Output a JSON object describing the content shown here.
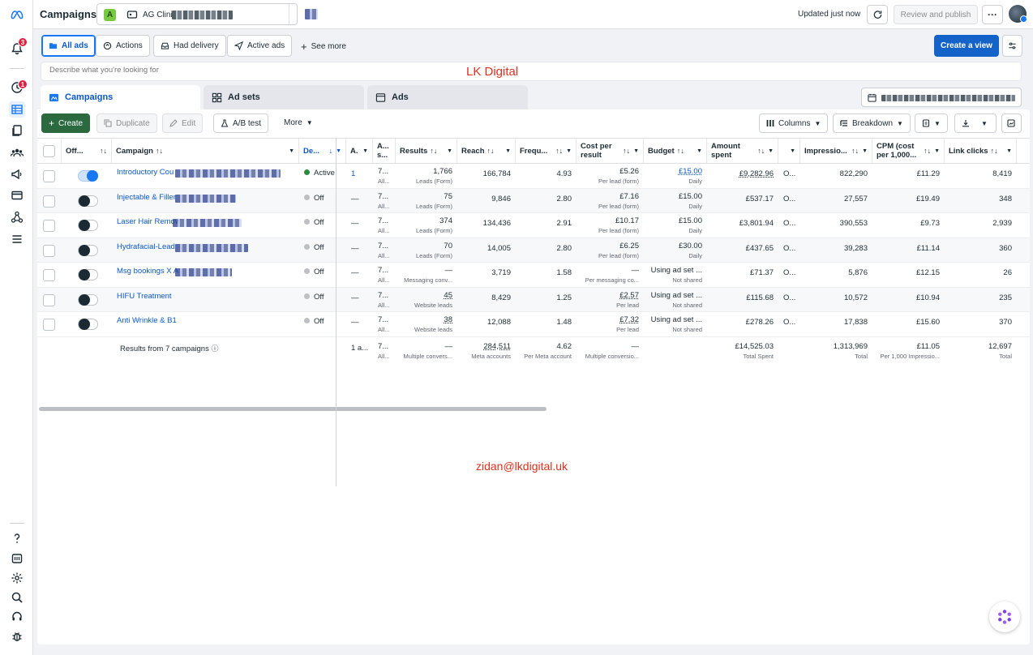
{
  "header": {
    "title": "Campaigns",
    "account_letter": "A",
    "account_name": "AG Clini",
    "updated": "Updated just now",
    "review_label": "Review and publish",
    "more_label": "···"
  },
  "rail": {
    "notifications_badge": "3",
    "activity_badge": "1"
  },
  "filters": {
    "chips": [
      "All ads",
      "Actions",
      "Had delivery",
      "Active ads"
    ],
    "see_more": "See more",
    "create_view": "Create a view"
  },
  "search": {
    "placeholder": "Describe what you're looking for"
  },
  "watermarks": {
    "top": "LK Digital",
    "bottom": "zidan@lkdigital.uk"
  },
  "tabs": [
    "Campaigns",
    "Ad sets",
    "Ads"
  ],
  "toolbar": {
    "create": "Create",
    "duplicate": "Duplicate",
    "edit": "Edit",
    "ab_test": "A/B test",
    "more": "More",
    "columns": "Columns",
    "breakdown": "Breakdown"
  },
  "table": {
    "headers": {
      "offon": "Off...",
      "campaign": "Campaign",
      "delivery": "De...",
      "a": "A.",
      "as": "A... s...",
      "results": "Results",
      "reach": "Reach",
      "frequency": "Frequ...",
      "cpr": "Cost per result",
      "budget": "Budget",
      "amount": "Amount spent",
      "impressions": "Impressio...",
      "cpm": "CPM (cost per 1,000...",
      "link_clicks": "Link clicks"
    },
    "rows": [
      {
        "name": "Introductory Cou",
        "on": true,
        "delivery": "Active",
        "delivery_color": "#2b8a3e",
        "a": "1",
        "as_main": "7...",
        "as_sub": "All...",
        "results": "1,766",
        "results_sub": "Leads (Form)",
        "reach": "166,784",
        "freq": "4.93",
        "cpr": "£5.26",
        "cpr_sub": "Per lead (form)",
        "budget": "£15.00",
        "budget_sub": "Daily",
        "amount": "£9,282.96",
        "o": "O...",
        "impr": "822,290",
        "cpm": "£11.29",
        "clicks": "8,419"
      },
      {
        "name": "Injectable & Filler",
        "on": false,
        "delivery": "Off",
        "delivery_color": "#bcc0c4",
        "a": "—",
        "as_main": "7...",
        "as_sub": "All...",
        "results": "75",
        "results_sub": "Leads (Form)",
        "reach": "9,846",
        "freq": "2.80",
        "cpr": "£7.16",
        "cpr_sub": "Per lead (form)",
        "budget": "£15.00",
        "budget_sub": "Daily",
        "amount": "£537.17",
        "o": "O...",
        "impr": "27,557",
        "cpm": "£19.49",
        "clicks": "348"
      },
      {
        "name": "Laser Hair Remov",
        "on": false,
        "delivery": "Off",
        "delivery_color": "#bcc0c4",
        "a": "—",
        "as_main": "7...",
        "as_sub": "All...",
        "results": "374",
        "results_sub": "Leads (Form)",
        "reach": "134,436",
        "freq": "2.91",
        "cpr": "£10.17",
        "cpr_sub": "Per lead (form)",
        "budget": "£15.00",
        "budget_sub": "Daily",
        "amount": "£3,801.94",
        "o": "O...",
        "impr": "390,553",
        "cpm": "£9.73",
        "clicks": "2,939"
      },
      {
        "name": "Hydrafacial-Lead",
        "on": false,
        "delivery": "Off",
        "delivery_color": "#bcc0c4",
        "a": "—",
        "as_main": "7...",
        "as_sub": "All...",
        "results": "70",
        "results_sub": "Leads (Form)",
        "reach": "14,005",
        "freq": "2.80",
        "cpr": "£6.25",
        "cpr_sub": "Per lead (form)",
        "budget": "£30.00",
        "budget_sub": "Daily",
        "amount": "£437.65",
        "o": "O...",
        "impr": "39,283",
        "cpm": "£11.14",
        "clicks": "360"
      },
      {
        "name": "Msg bookings X A",
        "on": false,
        "delivery": "Off",
        "delivery_color": "#bcc0c4",
        "a": "—",
        "as_main": "7...",
        "as_sub": "All...",
        "results": "—",
        "results_sub": "Messaging conv...",
        "reach": "3,719",
        "freq": "1.58",
        "cpr": "—",
        "cpr_sub": "Per messaging co...",
        "budget": "Using ad set ...",
        "budget_sub": "Not shared",
        "amount": "£71.37",
        "o": "O...",
        "impr": "5,876",
        "cpm": "£12.15",
        "clicks": "26"
      },
      {
        "name": "HIFU Treatment",
        "on": false,
        "delivery": "Off",
        "delivery_color": "#bcc0c4",
        "a": "—",
        "as_main": "7...",
        "as_sub": "All...",
        "results": "45",
        "results_sub": "Website leads",
        "reach": "8,429",
        "freq": "1.25",
        "cpr": "£2.57",
        "cpr_sub": "Per lead",
        "budget": "Using ad set ...",
        "budget_sub": "Not shared",
        "amount": "£115.68",
        "o": "O...",
        "impr": "10,572",
        "cpm": "£10.94",
        "clicks": "235"
      },
      {
        "name": "Anti Wrinkle & B1",
        "on": false,
        "delivery": "Off",
        "delivery_color": "#bcc0c4",
        "a": "—",
        "as_main": "7...",
        "as_sub": "All...",
        "results": "38",
        "results_sub": "Website leads",
        "reach": "12,088",
        "freq": "1.48",
        "cpr": "£7.32",
        "cpr_sub": "Per lead",
        "budget": "Using ad set ...",
        "budget_sub": "Not shared",
        "amount": "£278.26",
        "o": "O...",
        "impr": "17,838",
        "cpm": "£15.60",
        "clicks": "370"
      }
    ],
    "summary": {
      "label": "Results from 7 campaigns",
      "a": "1 a...",
      "as_main": "7...",
      "as_sub": "All...",
      "results": "—",
      "results_sub": "Multiple convers...",
      "reach": "284,511",
      "reach_sub": "Meta accounts",
      "freq": "4.62",
      "freq_sub": "Per Meta account",
      "cpr": "—",
      "cpr_sub": "Multiple conversio...",
      "amount": "£14,525.03",
      "amount_sub": "Total Spent",
      "impr": "1,313,969",
      "impr_sub": "Total",
      "cpm": "£11.05",
      "cpm_sub": "Per 1,000 Impressio...",
      "clicks": "12,697",
      "clicks_sub": "Total"
    }
  }
}
